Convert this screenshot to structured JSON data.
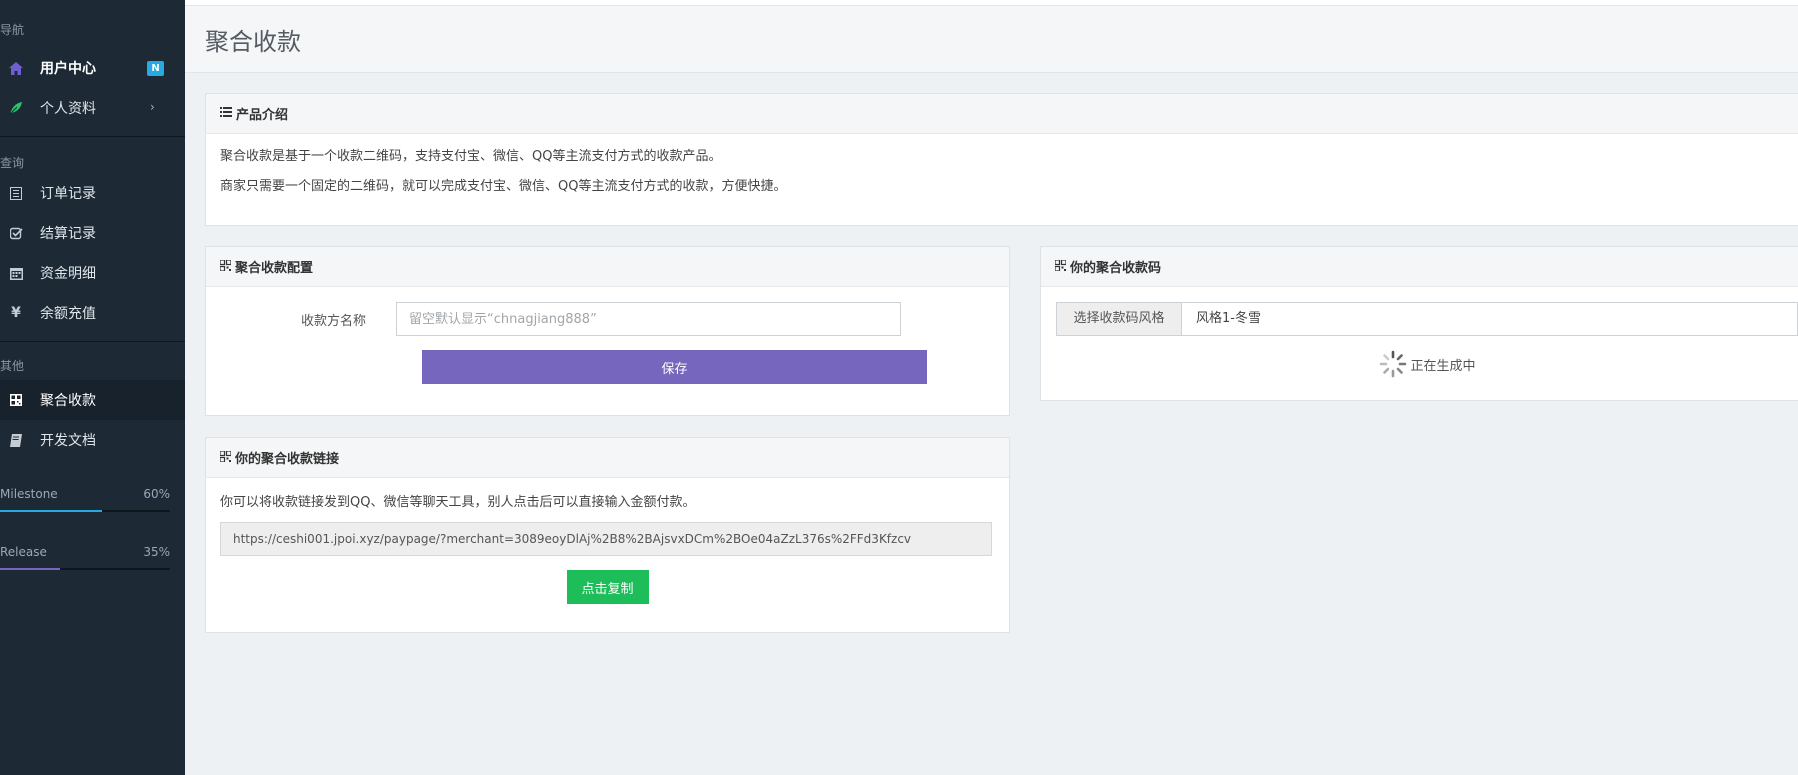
{
  "sidebar": {
    "sections": [
      {
        "title": "导航"
      },
      {
        "title": "查询"
      },
      {
        "title": "其他"
      }
    ],
    "items": [
      {
        "label": "用户中心",
        "icon": "home-icon",
        "badge": "N"
      },
      {
        "label": "个人资料",
        "icon": "leaf-icon",
        "chevron": "›"
      },
      {
        "label": "订单记录",
        "icon": "list-icon"
      },
      {
        "label": "结算记录",
        "icon": "check-square-icon"
      },
      {
        "label": "资金明细",
        "icon": "calendar-icon"
      },
      {
        "label": "余额充值",
        "icon": "yen-icon",
        "glyph": "¥"
      },
      {
        "label": "聚合收款",
        "icon": "qrcode-icon",
        "active": true
      },
      {
        "label": "开发文档",
        "icon": "book-icon"
      }
    ],
    "progress": [
      {
        "label": "Milestone",
        "value_text": "60%",
        "value": 0.6,
        "color": "#27a9e3"
      },
      {
        "label": "Release",
        "value_text": "35%",
        "value": 0.35,
        "color": "#7666bd"
      }
    ]
  },
  "page": {
    "title": "聚合收款"
  },
  "intro_panel": {
    "title": "产品介绍",
    "icon": "list-icon",
    "lines": [
      "聚合收款是基于一个收款二维码，支持支付宝、微信、QQ等主流支付方式的收款产品。",
      "商家只需要一个固定的二维码，就可以完成支付宝、微信、QQ等主流支付方式的收款，方便快捷。"
    ]
  },
  "config_panel": {
    "title": "聚合收款配置",
    "icon": "qrcode-icon",
    "field_label": "收款方名称",
    "field_placeholder": "留空默认显示“chnagjiang888”",
    "field_value": "",
    "save_label": "保存"
  },
  "link_panel": {
    "title": "你的聚合收款链接",
    "icon": "qrcode-icon",
    "description": "你可以将收款链接发到QQ、微信等聊天工具，别人点击后可以直接输入金额付款。",
    "url": "https://ceshi001.jpoi.xyz/paypage/?merchant=3089eoyDlAj%2B8%2BAjsvxDCm%2BOe04aZzL376s%2FFd3Kfzcv",
    "copy_label": "点击复制"
  },
  "code_panel": {
    "title": "你的聚合收款码",
    "icon": "qrcode-icon",
    "style_label": "选择收款码风格",
    "style_value": "风格1-冬雪",
    "status_text": "正在生成中"
  },
  "colors": {
    "sidebar_bg": "#1d2a36",
    "accent_purple": "#7666bd",
    "accent_green": "#1dbd5a",
    "badge_blue": "#27a9e3"
  }
}
